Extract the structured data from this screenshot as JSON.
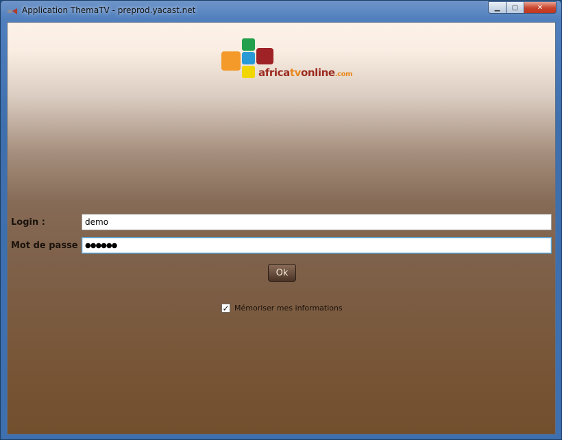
{
  "window": {
    "title": "Application ThemaTV - preprod.yacast.net",
    "caption_buttons": {
      "minimize": "▁",
      "maximize": "▢",
      "close": "✕"
    }
  },
  "logo": {
    "part_africa": "africa",
    "part_tv": "tv",
    "part_online": "online",
    "part_com": ".com",
    "tile_colors": [
      "#f39a2b",
      "#22a04b",
      "#2a9ad6",
      "#9e2226",
      "#f2d600"
    ]
  },
  "form": {
    "login_label": "Login :",
    "login_value": "demo",
    "password_label": "Mot de passe :",
    "password_value": "●●●●●●",
    "ok_label": "Ok",
    "remember_checked_glyph": "✓",
    "remember_label": "Mémoriser mes informations"
  }
}
